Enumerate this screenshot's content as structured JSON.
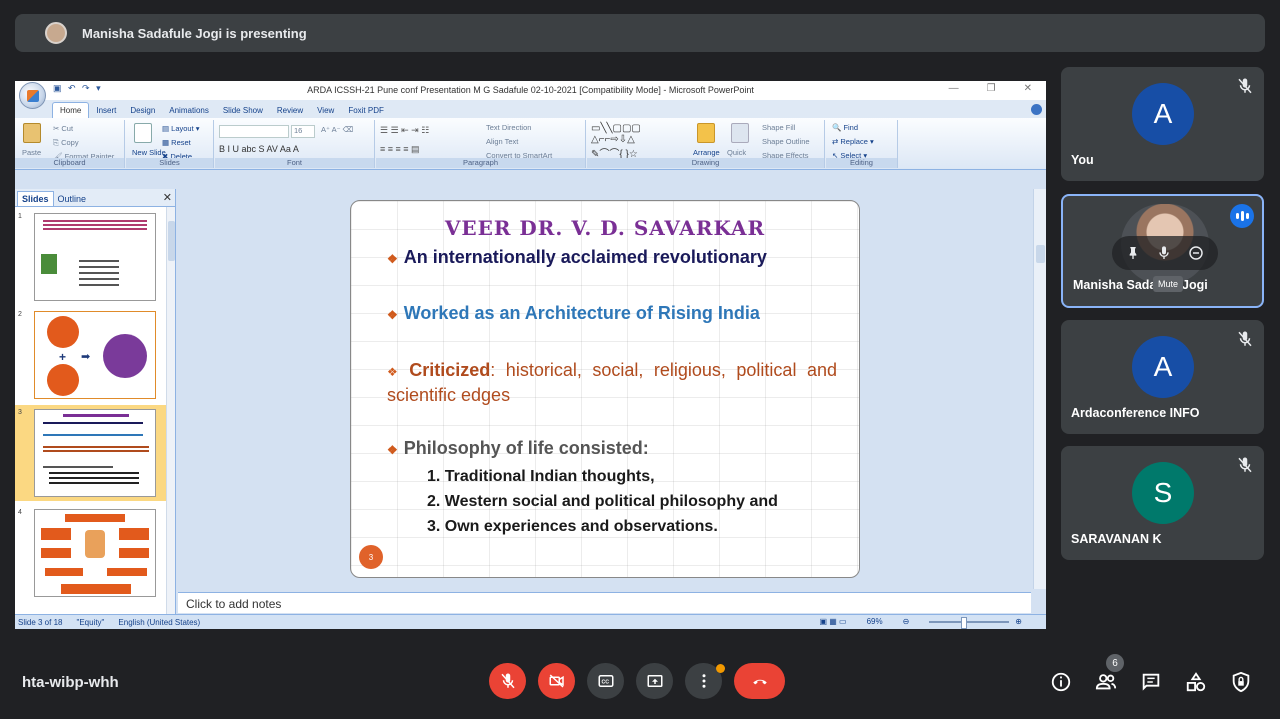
{
  "banner": {
    "text": "Manisha Sadafule Jogi is presenting"
  },
  "ppt": {
    "window_title": "ARDA ICSSH-21 Pune  conf Presentation M G Sadafule 02-10-2021 [Compatibility Mode] - Microsoft PowerPoint",
    "tabs": [
      "Home",
      "Insert",
      "Design",
      "Animations",
      "Slide Show",
      "Review",
      "View",
      "Foxit PDF"
    ],
    "ribbon": {
      "clipboard": {
        "label": "Clipboard",
        "paste": "Paste",
        "cut": "Cut",
        "copy": "Copy",
        "format_painter": "Format Painter"
      },
      "slides": {
        "label": "Slides",
        "new_slide": "New Slide",
        "layout": "Layout",
        "reset": "Reset",
        "delete": "Delete"
      },
      "font": {
        "label": "Font",
        "size": "16"
      },
      "paragraph": {
        "label": "Paragraph",
        "text_direction": "Text Direction",
        "align_text": "Align Text",
        "smartart": "Convert to SmartArt"
      },
      "drawing": {
        "label": "Drawing",
        "arrange": "Arrange",
        "quick_styles": "Quick Styles",
        "shape_fill": "Shape Fill",
        "shape_outline": "Shape Outline",
        "shape_effects": "Shape Effects"
      },
      "editing": {
        "label": "Editing",
        "find": "Find",
        "replace": "Replace",
        "select": "Select"
      }
    },
    "pane_tabs": {
      "slides": "Slides",
      "outline": "Outline"
    },
    "thumb_numbers": [
      "1",
      "2",
      "3",
      "4"
    ],
    "slide": {
      "title": "VEER DR. V. D. SAVARKAR",
      "bullet1": "An internationally acclaimed revolutionary",
      "bullet2": "Worked as an Architecture of Rising India",
      "bullet3_kw": "Criticized",
      "bullet3_rest": ": historical, social, religious, political and scientific edges",
      "bullet4": "Philosophy of life consisted:",
      "items": [
        "1. Traditional Indian thoughts,",
        "2. Western social and political philosophy and",
        "3. Own experiences and observations."
      ],
      "number": "3"
    },
    "notes": "Click to add notes",
    "status": {
      "slide": "Slide 3 of 18",
      "theme": "\"Equity\"",
      "language": "English (United States)",
      "zoom": "69%"
    }
  },
  "tiles": [
    {
      "initial": "A",
      "name": "You",
      "color": "#174ea6"
    },
    {
      "name": "Manisha Sadafule Jogi",
      "tooltip": "Mute"
    },
    {
      "initial": "A",
      "name": "Ardaconference INFO",
      "color": "#174ea6"
    },
    {
      "initial": "S",
      "name": "SARAVANAN K",
      "color": "#00796b"
    }
  ],
  "meeting": {
    "code": "hta-wibp-whh",
    "participants": "6"
  },
  "colors": {
    "accent": "#8ab4f8",
    "danger": "#ea4335",
    "bg": "#202124"
  }
}
